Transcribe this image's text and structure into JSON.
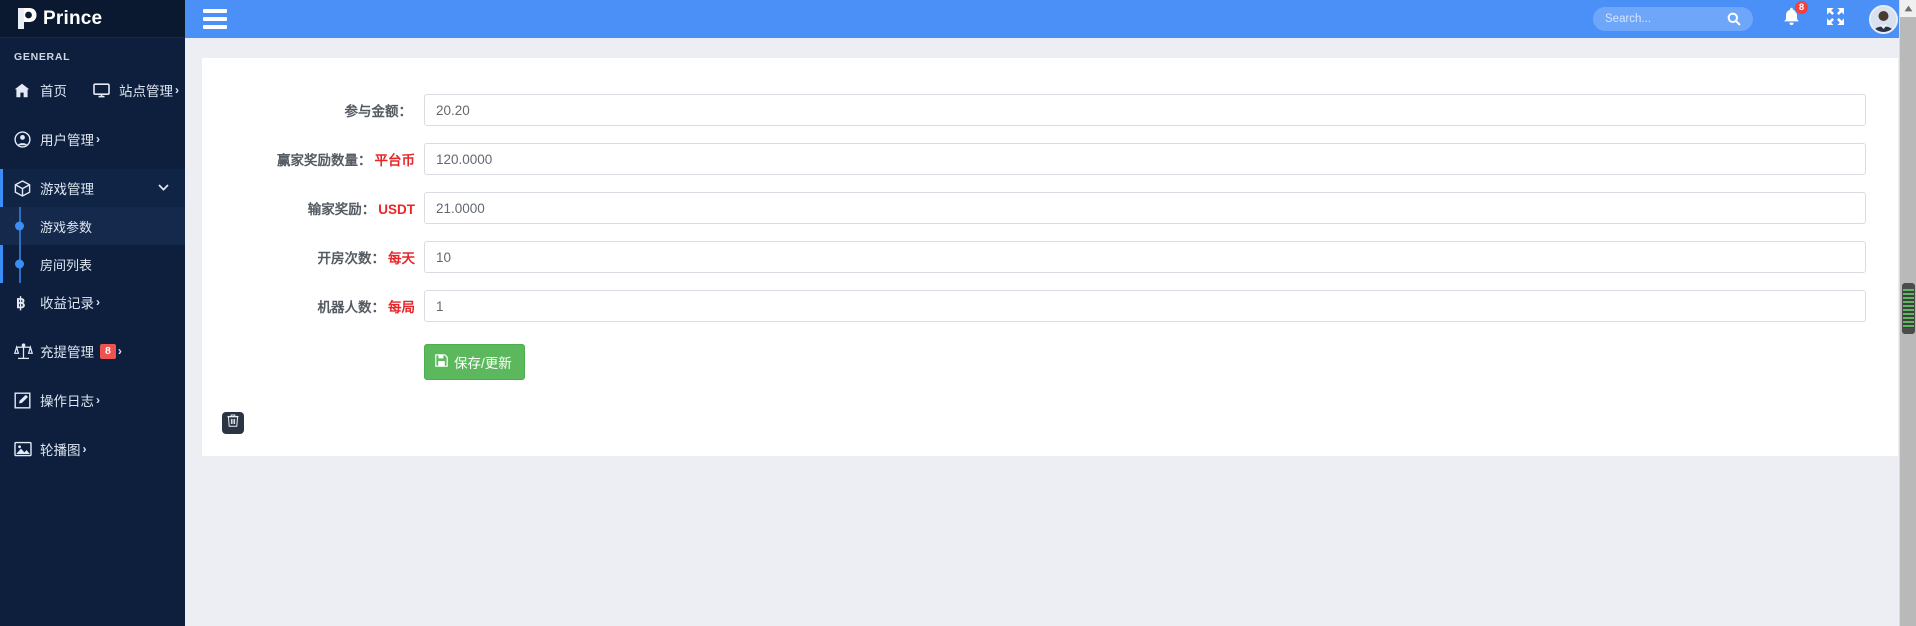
{
  "brand": {
    "name": "Prince",
    "logo_icon": "p-logo-icon"
  },
  "sidebar": {
    "section_label": "GENERAL",
    "items": [
      {
        "label": "首页",
        "icon": "home-icon",
        "caret": ""
      },
      {
        "label": "站点管理",
        "icon": "monitor-icon",
        "caret": "›"
      },
      {
        "label": "用户管理",
        "icon": "user-circle-icon",
        "caret": "›"
      },
      {
        "label": "游戏管理",
        "icon": "box-icon",
        "caret": "",
        "chevron": "⌄"
      },
      {
        "label": "收益记录",
        "icon": "bitcoin-icon",
        "caret": "›"
      },
      {
        "label": "充提管理",
        "icon": "scales-icon",
        "caret": "›",
        "badge": "8"
      },
      {
        "label": "操作日志",
        "icon": "edit-square-icon",
        "caret": "›"
      },
      {
        "label": "轮播图",
        "icon": "image-icon",
        "caret": "›"
      }
    ],
    "submenu": [
      {
        "label": "游戏参数",
        "active": true
      },
      {
        "label": "房间列表",
        "active": false
      }
    ]
  },
  "topbar": {
    "menu_toggle_icon": "hamburger-icon",
    "search": {
      "placeholder": "Search...",
      "value": "",
      "icon": "search-icon"
    },
    "notifications": {
      "icon": "bell-icon",
      "count": "8"
    },
    "fullscreen_icon": "expand-arrows-icon",
    "avatar_icon": "user-avatar"
  },
  "form": {
    "fields": [
      {
        "label": "参与金额：",
        "highlight": "",
        "value": "20.20",
        "name": "join-amount"
      },
      {
        "label": "赢家奖励数量：",
        "highlight": "平台币",
        "value": "120.0000",
        "name": "winner-reward-amount"
      },
      {
        "label": "输家奖励：",
        "highlight": "USDT",
        "value": "21.0000",
        "name": "loser-reward"
      },
      {
        "label": "开房次数：",
        "highlight": "每天",
        "value": "10",
        "name": "room-open-count"
      },
      {
        "label": "机器人数：",
        "highlight": "每局",
        "value": "1",
        "name": "robot-count"
      }
    ],
    "save_button": {
      "label": "保存/更新",
      "icon": "floppy-save-icon"
    }
  },
  "footer": {
    "trash_icon": "trash-icon"
  },
  "colors": {
    "sidebar_bg": "#0d1f3c",
    "topbar_blue": "#4a90f7",
    "accent_blue": "#3a8ef6",
    "danger_red": "#e8262a",
    "badge_red": "#ef5350",
    "save_green": "#5cb85c"
  }
}
